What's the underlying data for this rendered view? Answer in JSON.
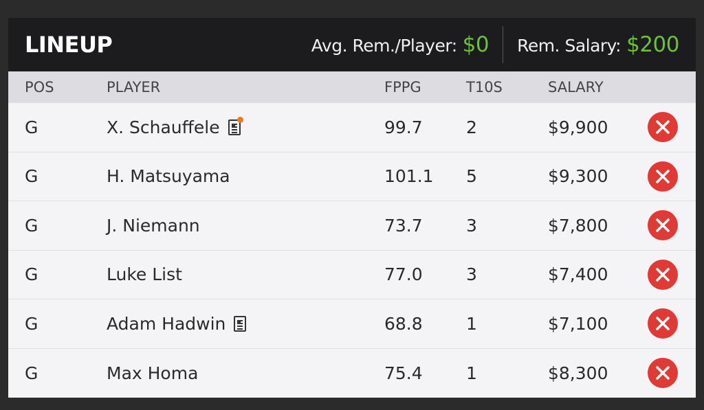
{
  "header": {
    "title": "LINEUP",
    "avg_rem_label": "Avg. Rem./Player:",
    "avg_rem_value": "$0",
    "rem_salary_label": "Rem. Salary:",
    "rem_salary_value": "$200",
    "accent_color": "#6cc03c"
  },
  "columns": {
    "pos": "POS",
    "player": "PLAYER",
    "fppg": "FPPG",
    "t10s": "T10S",
    "salary": "SALARY"
  },
  "rows": [
    {
      "pos": "G",
      "player": "X. Schauffele",
      "fppg": "99.7",
      "t10s": "2",
      "salary": "$9,900"
    },
    {
      "pos": "G",
      "player": "H. Matsuyama",
      "fppg": "101.1",
      "t10s": "5",
      "salary": "$9,300"
    },
    {
      "pos": "G",
      "player": "J. Niemann",
      "fppg": "73.7",
      "t10s": "3",
      "salary": "$7,800"
    },
    {
      "pos": "G",
      "player": "Luke List",
      "fppg": "77.0",
      "t10s": "3",
      "salary": "$7,400"
    },
    {
      "pos": "G",
      "player": "Adam Hadwin",
      "fppg": "68.8",
      "t10s": "1",
      "salary": "$7,100"
    },
    {
      "pos": "G",
      "player": "Max Homa",
      "fppg": "75.4",
      "t10s": "1",
      "salary": "$8,300"
    }
  ],
  "icons": {
    "news": "news-icon",
    "remove": "remove-icon"
  }
}
